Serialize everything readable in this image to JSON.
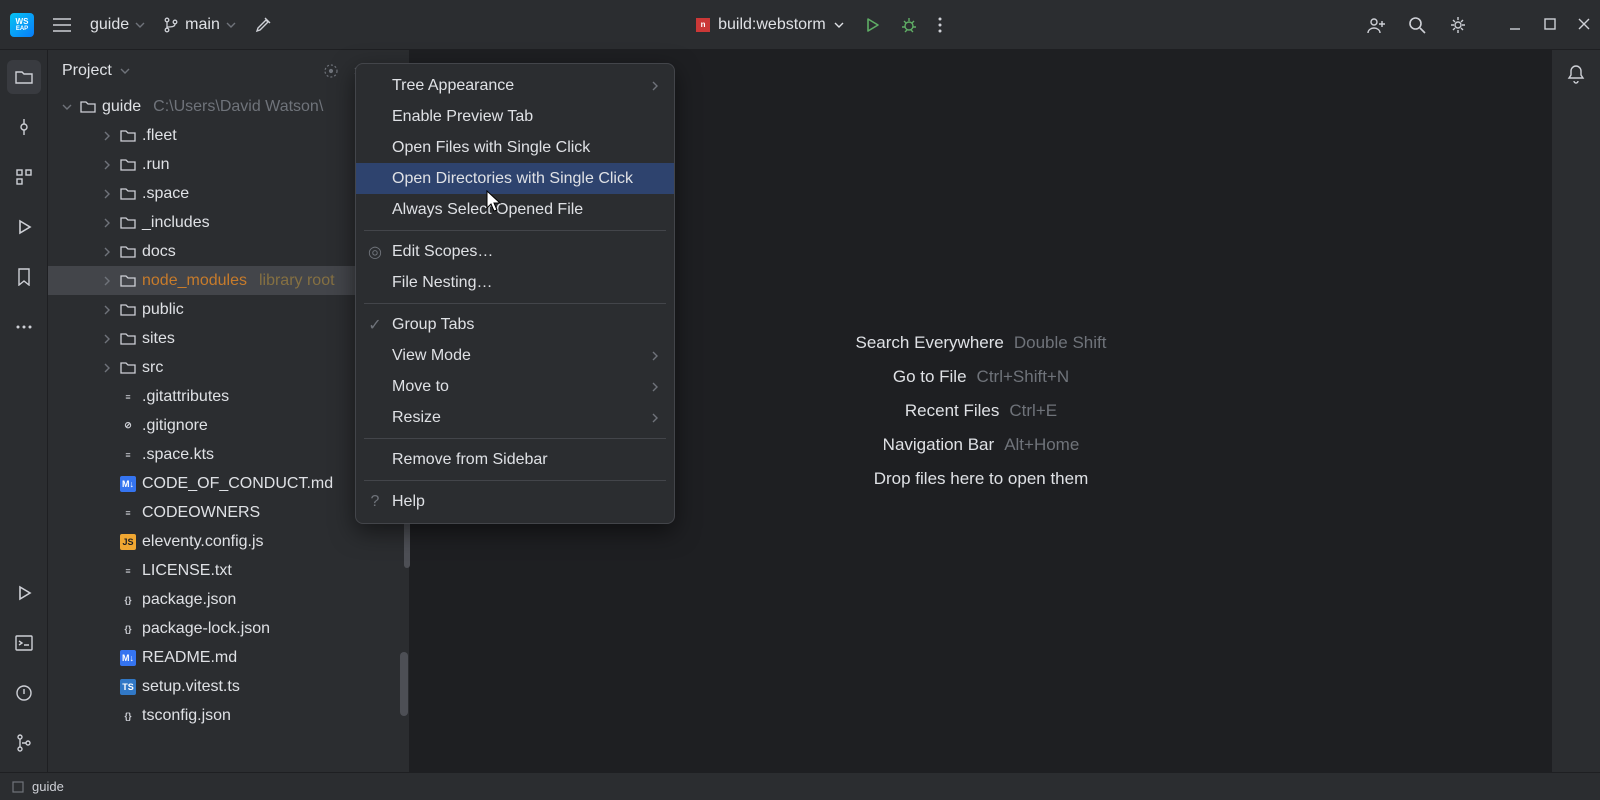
{
  "titlebar": {
    "project_crumb": "guide",
    "branch_name": "main",
    "run_config": "build:webstorm"
  },
  "panel": {
    "title": "Project"
  },
  "tree": {
    "root_name": "guide",
    "root_path": "C:\\Users\\David Watson\\",
    "items": [
      {
        "name": ".fleet",
        "type": "folder",
        "indent": 2
      },
      {
        "name": ".run",
        "type": "folder",
        "indent": 2
      },
      {
        "name": ".space",
        "type": "folder",
        "indent": 2
      },
      {
        "name": "_includes",
        "type": "folder",
        "indent": 2
      },
      {
        "name": "docs",
        "type": "folder",
        "indent": 2
      },
      {
        "name": "node_modules",
        "type": "folder",
        "indent": 2,
        "lib": true,
        "suffix": "library root"
      },
      {
        "name": "public",
        "type": "folder",
        "indent": 2
      },
      {
        "name": "sites",
        "type": "folder",
        "indent": 2
      },
      {
        "name": "src",
        "type": "folder",
        "indent": 2
      },
      {
        "name": ".gitattributes",
        "type": "file-txt",
        "indent": 2
      },
      {
        "name": ".gitignore",
        "type": "file-ignore",
        "indent": 2
      },
      {
        "name": ".space.kts",
        "type": "file-txt",
        "indent": 2
      },
      {
        "name": "CODE_OF_CONDUCT.md",
        "type": "file-md",
        "indent": 2
      },
      {
        "name": "CODEOWNERS",
        "type": "file-txt",
        "indent": 2
      },
      {
        "name": "eleventy.config.js",
        "type": "file-js",
        "indent": 2
      },
      {
        "name": "LICENSE.txt",
        "type": "file-txt",
        "indent": 2
      },
      {
        "name": "package.json",
        "type": "file-brace",
        "indent": 2
      },
      {
        "name": "package-lock.json",
        "type": "file-brace",
        "indent": 2
      },
      {
        "name": "README.md",
        "type": "file-md",
        "indent": 2
      },
      {
        "name": "setup.vitest.ts",
        "type": "file-ts",
        "indent": 2
      },
      {
        "name": "tsconfig.json",
        "type": "file-brace",
        "indent": 2
      }
    ]
  },
  "context_menu": {
    "items": [
      {
        "label": "Tree Appearance",
        "submenu": true
      },
      {
        "label": "Enable Preview Tab"
      },
      {
        "label": "Open Files with Single Click"
      },
      {
        "label": "Open Directories with Single Click",
        "hovered": true
      },
      {
        "label": "Always Select Opened File"
      },
      {
        "sep": true
      },
      {
        "label": "Edit Scopes…",
        "icon": "target"
      },
      {
        "label": "File Nesting…"
      },
      {
        "sep": true
      },
      {
        "label": "Group Tabs",
        "icon": "check"
      },
      {
        "label": "View Mode",
        "submenu": true
      },
      {
        "label": "Move to",
        "submenu": true
      },
      {
        "label": "Resize",
        "submenu": true
      },
      {
        "sep": true
      },
      {
        "label": "Remove from Sidebar"
      },
      {
        "sep": true
      },
      {
        "label": "Help",
        "icon": "question"
      }
    ]
  },
  "welcome": {
    "rows": [
      {
        "action": "Search Everywhere",
        "shortcut": "Double Shift"
      },
      {
        "action": "Go to File",
        "shortcut": "Ctrl+Shift+N"
      },
      {
        "action": "Recent Files",
        "shortcut": "Ctrl+E"
      },
      {
        "action": "Navigation Bar",
        "shortcut": "Alt+Home"
      }
    ],
    "drop": "Drop files here to open them"
  },
  "statusbar": {
    "project": "guide"
  }
}
